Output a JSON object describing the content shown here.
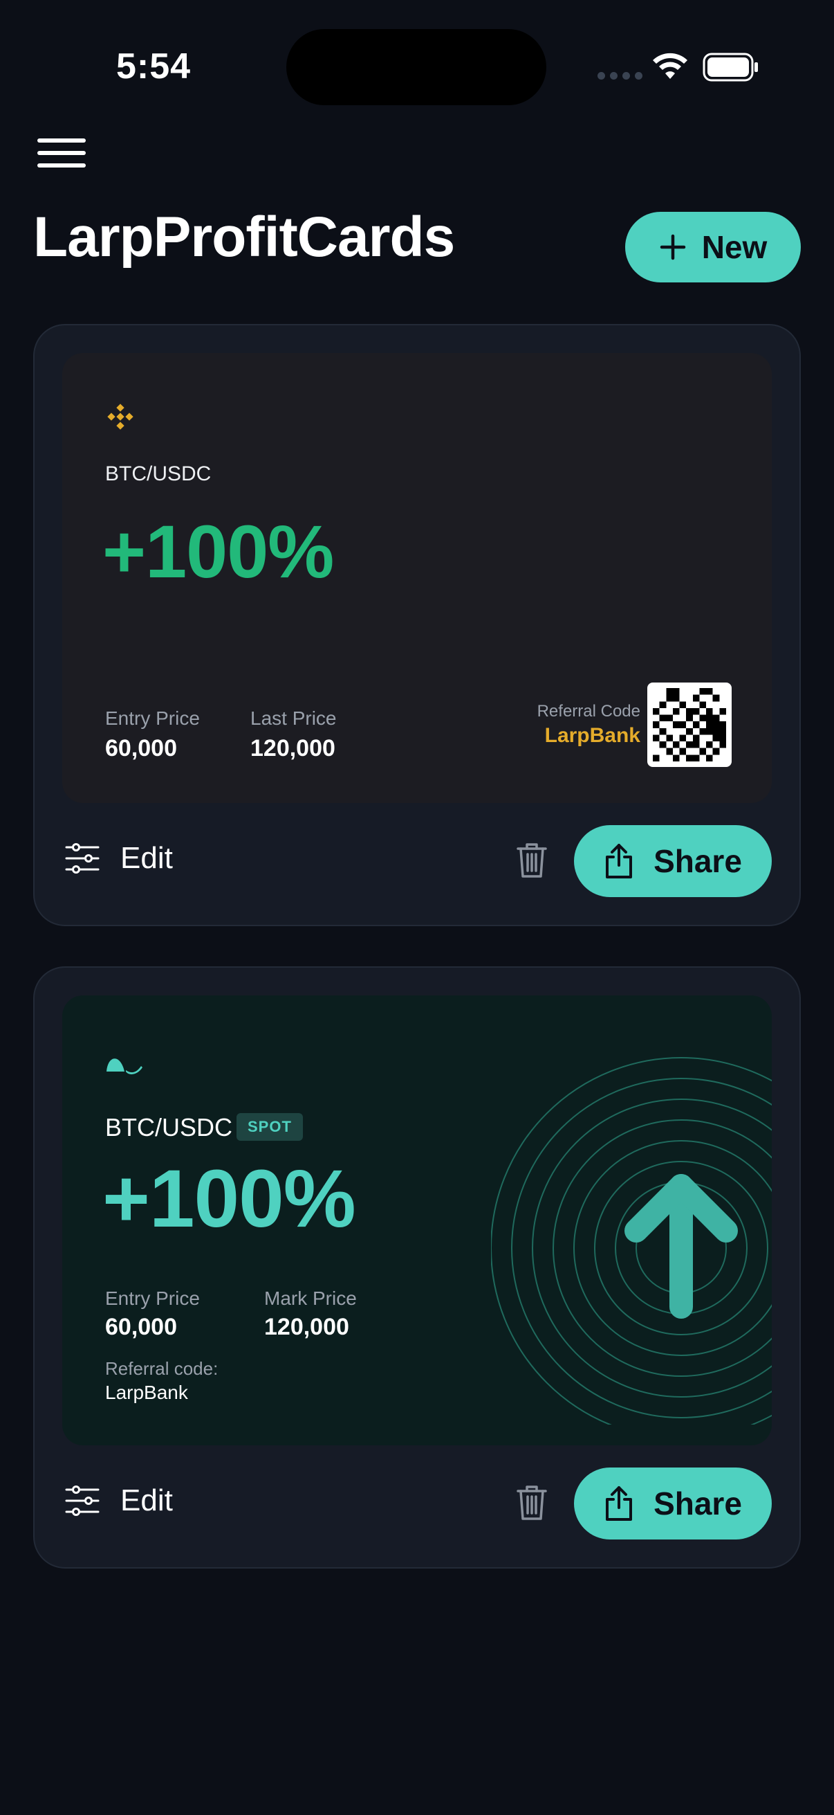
{
  "status_bar": {
    "time": "5:54"
  },
  "header": {
    "title": "LarpProfitCards",
    "new_label": "New"
  },
  "cards": [
    {
      "pair": "BTC/USDC",
      "pnl": "+100%",
      "entry_label": "Entry Price",
      "entry_value": "60,000",
      "last_label": "Last Price",
      "last_value": "120,000",
      "referral_label": "Referral Code",
      "referral_value": "LarpBank",
      "accent": "#22b97a",
      "brand_color": "#e5ac2b"
    },
    {
      "pair": "BTC/USDC",
      "badge": "SPOT",
      "pnl": "+100%",
      "entry_label": "Entry Price",
      "entry_value": "60,000",
      "mark_label": "Mark Price",
      "mark_value": "120,000",
      "referral_label": "Referral code:",
      "referral_value": "LarpBank",
      "accent": "#4fd1c0"
    }
  ],
  "actions": {
    "edit_label": "Edit",
    "share_label": "Share"
  },
  "icons": [
    "menu-icon",
    "plus-icon",
    "sliders-icon",
    "trash-icon",
    "share-icon",
    "wifi-icon",
    "battery-icon",
    "qr-code-icon",
    "arrow-up-icon"
  ]
}
